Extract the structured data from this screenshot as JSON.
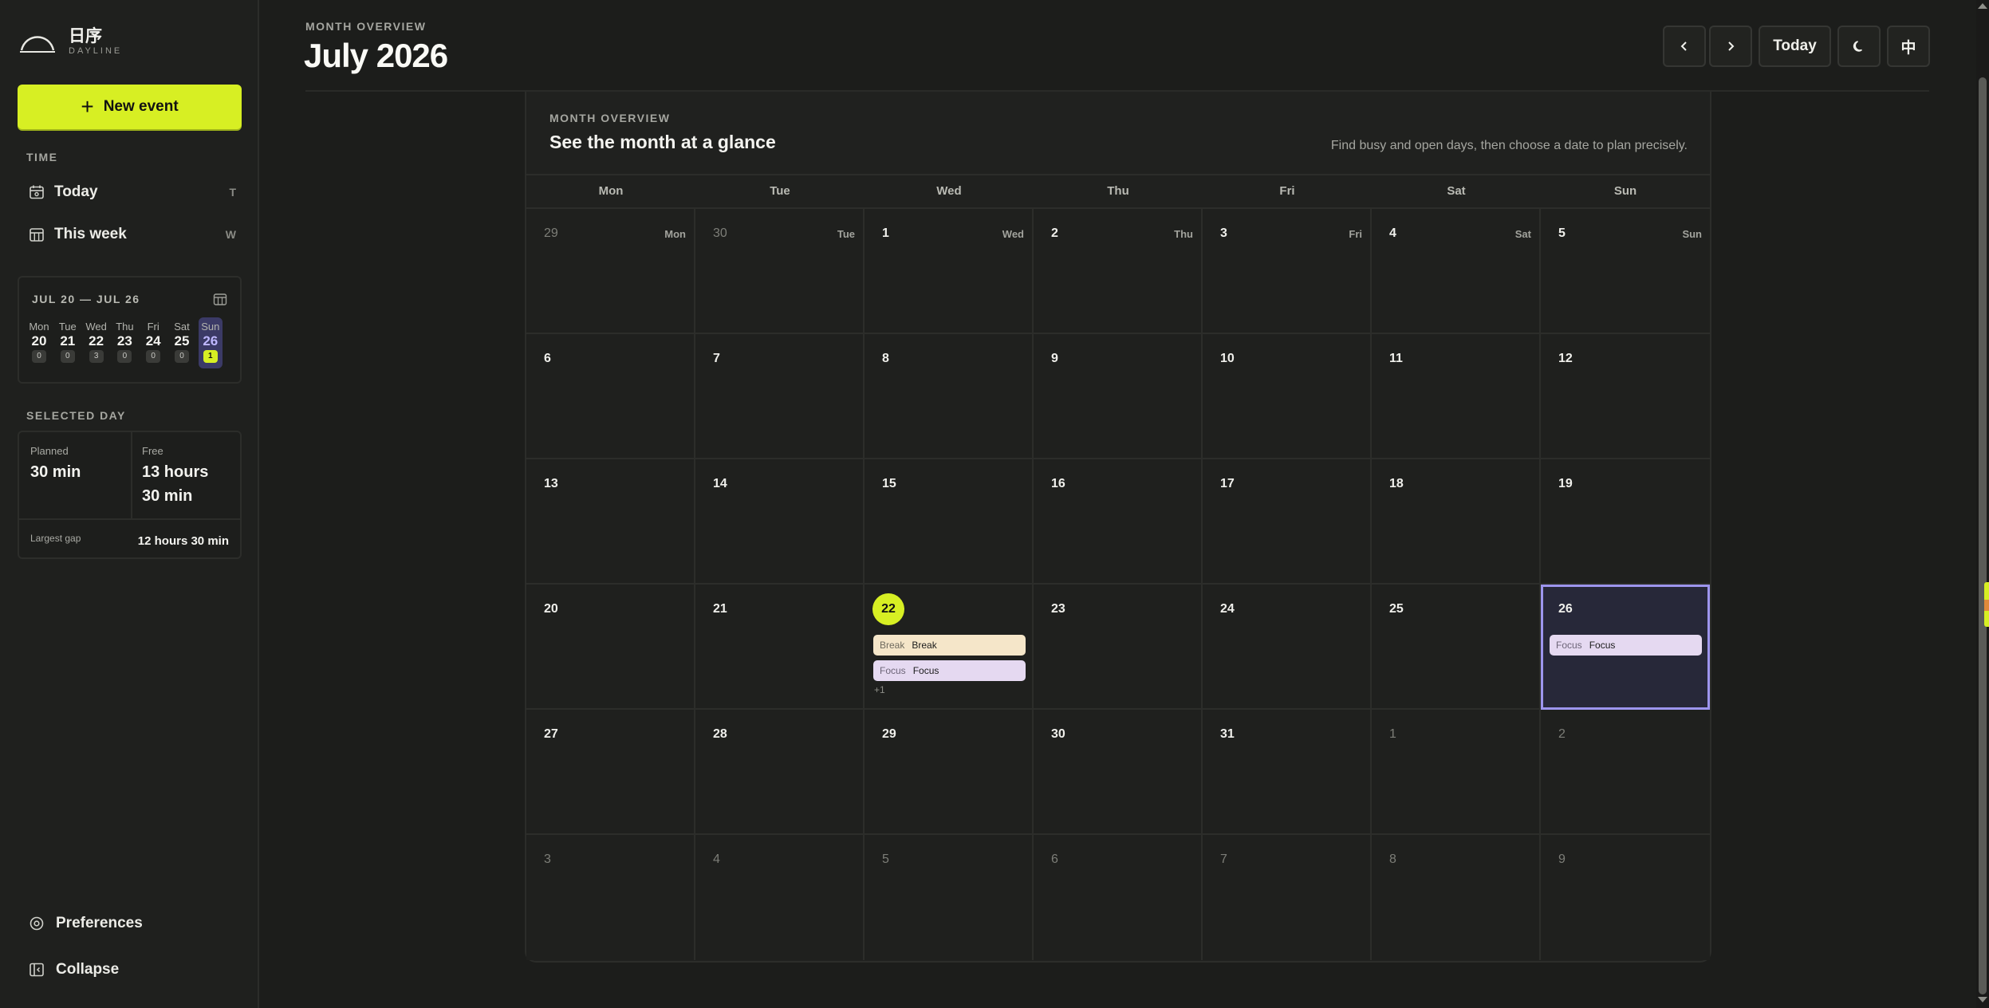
{
  "app": {
    "logo_cn": "日序",
    "logo_en": "DAYLINE",
    "brand_color": "#d7ef23",
    "selected_color": "#9d95ee"
  },
  "sidebar": {
    "new_event_label": "New event",
    "time_section": "TIME",
    "nav": [
      {
        "label": "Today",
        "key": "T",
        "icon": "calendar-today-icon"
      },
      {
        "label": "This week",
        "key": "W",
        "icon": "calendar-week-icon"
      }
    ],
    "week": {
      "range": "JUL 20 — JUL 26",
      "days": [
        {
          "name": "Mon",
          "date": "20",
          "count": "0"
        },
        {
          "name": "Tue",
          "date": "21",
          "count": "0"
        },
        {
          "name": "Wed",
          "date": "22",
          "count": "3"
        },
        {
          "name": "Thu",
          "date": "23",
          "count": "0"
        },
        {
          "name": "Fri",
          "date": "24",
          "count": "0"
        },
        {
          "name": "Sat",
          "date": "25",
          "count": "0"
        },
        {
          "name": "Sun",
          "date": "26",
          "count": "1"
        }
      ]
    },
    "selected_section": "SELECTED DAY",
    "stats": {
      "planned_label": "Planned",
      "planned_value": "30 min",
      "free_label": "Free",
      "free_value_1": "13 hours",
      "free_value_2": "30 min",
      "gap_label": "Largest gap",
      "gap_value": "12 hours 30 min"
    },
    "preferences_label": "Preferences",
    "collapse_label": "Collapse"
  },
  "header": {
    "kicker": "MONTH OVERVIEW",
    "title": "July 2026",
    "today_label": "Today",
    "lang_label": "中"
  },
  "panel": {
    "kicker": "MONTH OVERVIEW",
    "title": "See the month at a glance",
    "hint": "Find busy and open days, then choose a date to plan precisely.",
    "weekdays": [
      "Mon",
      "Tue",
      "Wed",
      "Thu",
      "Fri",
      "Sat",
      "Sun"
    ],
    "days": [
      {
        "n": "29",
        "out": true,
        "label": "Mon"
      },
      {
        "n": "30",
        "out": true,
        "label": "Tue"
      },
      {
        "n": "1",
        "label": "Wed"
      },
      {
        "n": "2",
        "label": "Thu"
      },
      {
        "n": "3",
        "label": "Fri"
      },
      {
        "n": "4",
        "label": "Sat"
      },
      {
        "n": "5",
        "label": "Sun"
      },
      {
        "n": "6"
      },
      {
        "n": "7"
      },
      {
        "n": "8"
      },
      {
        "n": "9"
      },
      {
        "n": "10"
      },
      {
        "n": "11"
      },
      {
        "n": "12"
      },
      {
        "n": "13"
      },
      {
        "n": "14"
      },
      {
        "n": "15"
      },
      {
        "n": "16"
      },
      {
        "n": "17"
      },
      {
        "n": "18"
      },
      {
        "n": "19"
      },
      {
        "n": "20"
      },
      {
        "n": "21"
      },
      {
        "n": "22",
        "today": true,
        "events": [
          {
            "kind": "Break",
            "title": "Break",
            "type": "break"
          },
          {
            "kind": "Focus",
            "title": "Focus",
            "type": "focus"
          }
        ],
        "more": "+1"
      },
      {
        "n": "23"
      },
      {
        "n": "24"
      },
      {
        "n": "25"
      },
      {
        "n": "26",
        "selected": true,
        "events": [
          {
            "kind": "Focus",
            "title": "Focus",
            "type": "focus"
          }
        ]
      },
      {
        "n": "27"
      },
      {
        "n": "28"
      },
      {
        "n": "29"
      },
      {
        "n": "30"
      },
      {
        "n": "31"
      },
      {
        "n": "1",
        "out": true
      },
      {
        "n": "2",
        "out": true
      },
      {
        "n": "3",
        "out": true
      },
      {
        "n": "4",
        "out": true
      },
      {
        "n": "5",
        "out": true
      },
      {
        "n": "6",
        "out": true
      },
      {
        "n": "7",
        "out": true
      },
      {
        "n": "8",
        "out": true
      },
      {
        "n": "9",
        "out": true
      }
    ]
  }
}
